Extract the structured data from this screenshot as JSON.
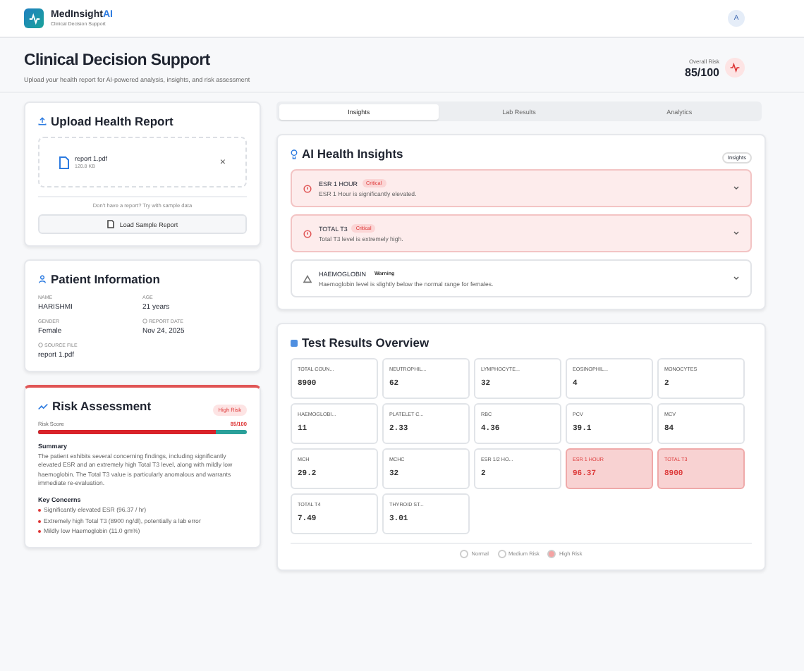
{
  "app": {
    "name": "MedInsight",
    "name_accent": "AI",
    "tagline": "Clinical Decision Support",
    "avatar": "A"
  },
  "page": {
    "title": "Clinical Decision Support",
    "subtitle": "Upload your health report for AI-powered analysis, insights, and risk assessment",
    "overall_risk_label": "Overall Risk",
    "overall_risk": "85/100"
  },
  "upload": {
    "title": "Upload Health Report",
    "file_name": "report 1.pdf",
    "file_size": "120.8 KB",
    "remove": "×",
    "hint": "Don't have a report? Try with sample data",
    "button": "Load Sample Report"
  },
  "patient": {
    "title": "Patient Information",
    "fields": [
      {
        "label": "NAME",
        "value": "HARISHMI",
        "icon": false
      },
      {
        "label": "AGE",
        "value": "21 years",
        "icon": false
      },
      {
        "label": "GENDER",
        "value": "Female",
        "icon": false
      },
      {
        "label": "REPORT DATE",
        "value": "Nov 24, 2025",
        "icon": true
      },
      {
        "label": "SOURCE FILE",
        "value": "report 1.pdf",
        "icon": true
      }
    ]
  },
  "risk": {
    "title": "Risk Assessment",
    "badge": "High Risk",
    "score_label": "Risk Score",
    "score": "85/100",
    "level": 0.85,
    "summary_title": "Summary",
    "summary": "The patient exhibits several concerning findings, including significantly elevated ESR and an extremely high Total T3 level, along with mildly low haemoglobin. The Total T3 value is particularly anomalous and warrants immediate re-evaluation.",
    "concerns_title": "Key Concerns",
    "concerns": [
      "Significantly elevated ESR (96.37 / hr)",
      "Extremely high Total T3 (8900 ng/dl), potentially a lab error",
      "Mildly low Haemoglobin (11.0 gm%)"
    ]
  },
  "tabs": [
    {
      "label": "Insights",
      "selected": true
    },
    {
      "label": "Lab Results",
      "selected": false
    },
    {
      "label": "Analytics",
      "selected": false
    }
  ],
  "insights": {
    "title": "AI Health Insights",
    "badge": "Insights",
    "items": [
      {
        "kind": "critical",
        "name": "ESR 1 HOUR",
        "tag": "Critical",
        "text": "ESR 1 Hour is significantly elevated."
      },
      {
        "kind": "critical",
        "name": "TOTAL T3",
        "tag": "Critical",
        "text": "Total T3 level is extremely high."
      },
      {
        "kind": "warning",
        "name": "HAEMOGLOBIN",
        "tag": "Warning",
        "text": "Haemoglobin level is slightly below the normal range for females."
      }
    ]
  },
  "results": {
    "title": "Test Results Overview",
    "tests": [
      {
        "name": "TOTAL COUN...",
        "value": "8900",
        "high_risk": false
      },
      {
        "name": "NEUTROPHIL...",
        "value": "62",
        "high_risk": false
      },
      {
        "name": "LYMPHOCYTE...",
        "value": "32",
        "high_risk": false
      },
      {
        "name": "EOSINOPHIL...",
        "value": "4",
        "high_risk": false
      },
      {
        "name": "MONOCYTES",
        "value": "2",
        "high_risk": false
      },
      {
        "name": "HAEMOGLOBI...",
        "value": "11",
        "high_risk": false
      },
      {
        "name": "PLATELET C...",
        "value": "2.33",
        "high_risk": false
      },
      {
        "name": "RBC",
        "value": "4.36",
        "high_risk": false
      },
      {
        "name": "PCV",
        "value": "39.1",
        "high_risk": false
      },
      {
        "name": "MCV",
        "value": "84",
        "high_risk": false
      },
      {
        "name": "MCH",
        "value": "29.2",
        "high_risk": false
      },
      {
        "name": "MCHC",
        "value": "32",
        "high_risk": false
      },
      {
        "name": "ESR 1/2 HO...",
        "value": "2",
        "high_risk": false
      },
      {
        "name": "ESR 1 HOUR",
        "value": "96.37",
        "high_risk": true
      },
      {
        "name": "TOTAL T3",
        "value": "8900",
        "high_risk": true
      },
      {
        "name": "TOTAL T4",
        "value": "7.49",
        "high_risk": false
      },
      {
        "name": "THYROID ST...",
        "value": "3.01",
        "high_risk": false
      }
    ],
    "legend": [
      {
        "label": "Normal",
        "color": "#ffffff"
      },
      {
        "label": "Medium Risk",
        "color": "#ffffff"
      },
      {
        "label": "High Risk",
        "color": "#f4a3a3"
      }
    ]
  }
}
